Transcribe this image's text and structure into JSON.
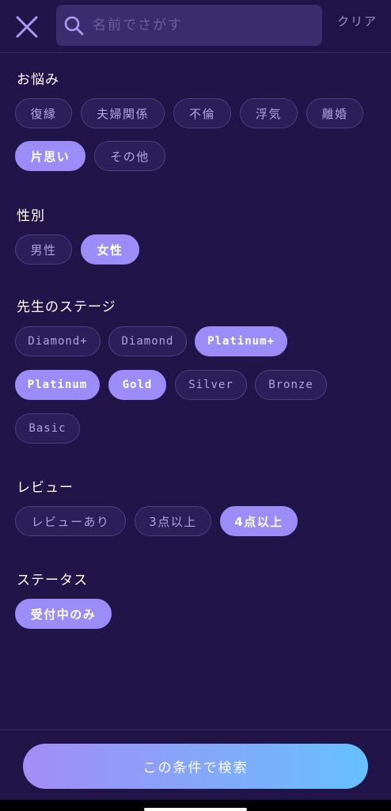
{
  "header": {
    "search_placeholder": "名前でさがす",
    "clear_label": "クリア"
  },
  "sections": {
    "concerns": {
      "title": "お悩み",
      "options": [
        "復縁",
        "夫婦関係",
        "不倫",
        "浮気",
        "離婚",
        "片思い",
        "その他"
      ],
      "selected": [
        "片思い"
      ]
    },
    "gender": {
      "title": "性別",
      "options": [
        "男性",
        "女性"
      ],
      "selected": [
        "女性"
      ]
    },
    "stage": {
      "title": "先生のステージ",
      "options": [
        "Diamond+",
        "Diamond",
        "Platinum+",
        "Platinum",
        "Gold",
        "Silver",
        "Bronze",
        "Basic"
      ],
      "selected": [
        "Platinum+",
        "Platinum",
        "Gold"
      ]
    },
    "review": {
      "title": "レビュー",
      "options": [
        "レビューあり",
        "3点以上",
        "4点以上"
      ],
      "selected": [
        "4点以上"
      ]
    },
    "status": {
      "title": "ステータス",
      "options": [
        "受付中のみ"
      ],
      "selected": [
        "受付中のみ"
      ]
    }
  },
  "footer": {
    "search_button_label": "この条件で検索"
  },
  "colors": {
    "background": "#211448",
    "chip_selected": "#9b8cf7",
    "chip_unselected": "#2b1e5a",
    "button_gradient_start": "#a48cf6",
    "button_gradient_end": "#66c0fd"
  },
  "icons": {
    "close": "close-icon",
    "search": "search-icon"
  }
}
